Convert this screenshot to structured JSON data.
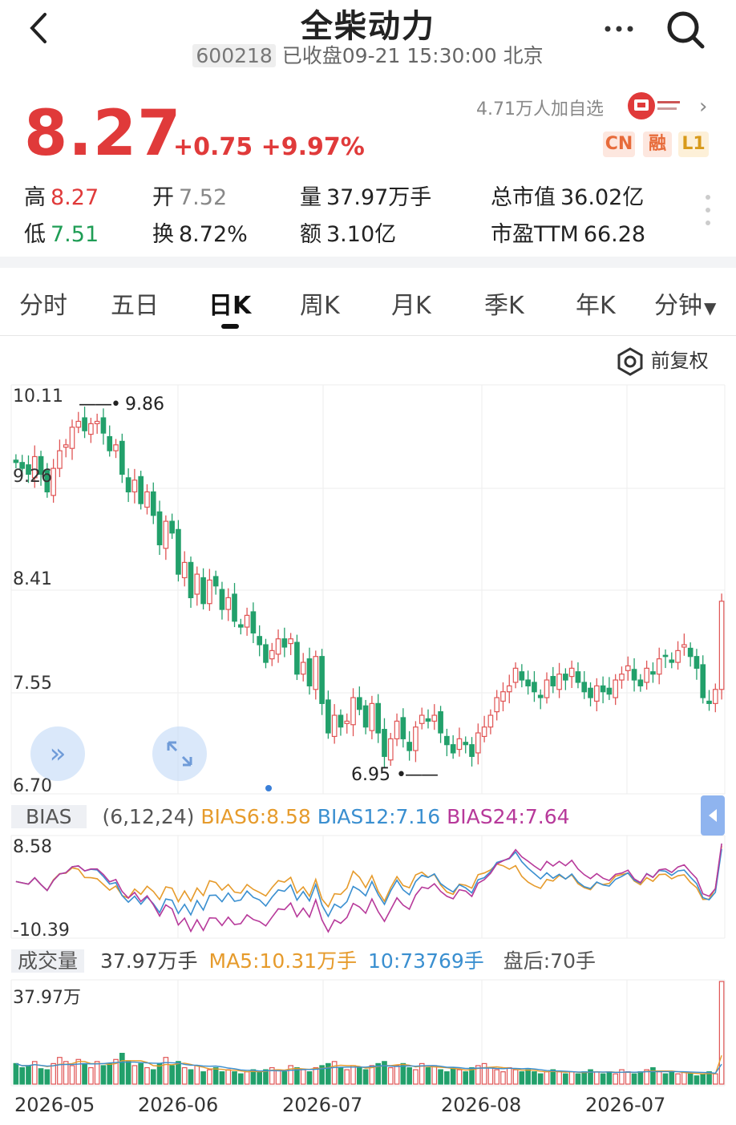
{
  "header": {
    "title": "全柴动力",
    "code": "600218",
    "status": "已收盘09-21 15:30:00 北京"
  },
  "quote": {
    "price": "8.27",
    "change": "+0.75",
    "change_pct": "+9.97%",
    "followers": "4.71万人加自选",
    "tags": [
      "CN",
      "融",
      "L1"
    ],
    "stats": [
      {
        "label": "高",
        "value": "8.27",
        "tone": "red"
      },
      {
        "label": "开",
        "value": "7.52",
        "tone": "gray"
      },
      {
        "label": "量",
        "value": "37.97万手",
        "tone": "dark"
      },
      {
        "label": "总市值",
        "value": "36.02亿",
        "tone": "dark"
      },
      {
        "label": "低",
        "value": "7.51",
        "tone": "green"
      },
      {
        "label": "换",
        "value": "8.72%",
        "tone": "dark"
      },
      {
        "label": "额",
        "value": "3.10亿",
        "tone": "dark"
      },
      {
        "label": "市盈TTM",
        "value": "66.28",
        "tone": "dark"
      }
    ]
  },
  "tabs": [
    "分时",
    "五日",
    "日K",
    "周K",
    "月K",
    "季K",
    "年K",
    "分钟"
  ],
  "active_tab": "日K",
  "adjust_label": "前复权",
  "chart_data": [
    {
      "type": "candlestick",
      "y_ticks": [
        "10.11",
        "9.26",
        "8.41",
        "7.55",
        "6.70"
      ],
      "ylim": [
        6.7,
        10.11
      ],
      "annotations": [
        {
          "label": "9.86",
          "value": 9.86
        },
        {
          "label": "6.95",
          "value": 6.95
        }
      ],
      "x_ticks": [
        "2026-05",
        "2026-06",
        "2026-07",
        "2026-08",
        "2026-07"
      ],
      "close": [
        9.45,
        9.4,
        9.35,
        9.5,
        9.35,
        9.2,
        9.4,
        9.55,
        9.6,
        9.75,
        9.8,
        9.72,
        9.78,
        9.8,
        9.7,
        9.55,
        9.6,
        9.35,
        9.2,
        9.3,
        9.1,
        9.2,
        9.0,
        8.75,
        8.95,
        8.85,
        8.5,
        8.6,
        8.3,
        8.5,
        8.25,
        8.45,
        8.4,
        8.2,
        8.3,
        8.1,
        8.05,
        8.15,
        8.0,
        7.9,
        7.75,
        7.85,
        7.95,
        7.88,
        7.95,
        7.65,
        7.75,
        7.55,
        7.8,
        7.4,
        7.15,
        7.3,
        7.2,
        7.25,
        7.45,
        7.35,
        7.2,
        7.4,
        7.15,
        6.95,
        7.1,
        7.25,
        7.1,
        7.0,
        7.2,
        7.3,
        7.25,
        7.3,
        7.15,
        7.05,
        6.98,
        7.1,
        7.05,
        6.95,
        7.15,
        7.2,
        7.3,
        7.45,
        7.5,
        7.55,
        7.7,
        7.6,
        7.55,
        7.5,
        7.45,
        7.6,
        7.55,
        7.65,
        7.6,
        7.7,
        7.58,
        7.5,
        7.45,
        7.55,
        7.5,
        7.48,
        7.6,
        7.65,
        7.72,
        7.6,
        7.55,
        7.7,
        7.65,
        7.78,
        7.8,
        7.75,
        7.85,
        7.9,
        7.8,
        7.7,
        7.45,
        7.4,
        7.52,
        8.27
      ],
      "volume": [
        0.2,
        0.16,
        0.18,
        0.22,
        0.15,
        0.14,
        0.2,
        0.26,
        0.22,
        0.18,
        0.24,
        0.2,
        0.16,
        0.22,
        0.18,
        0.2,
        0.24,
        0.3,
        0.22,
        0.18,
        0.2,
        0.16,
        0.14,
        0.2,
        0.26,
        0.18,
        0.22,
        0.16,
        0.14,
        0.18,
        0.12,
        0.14,
        0.16,
        0.12,
        0.14,
        0.12,
        0.1,
        0.12,
        0.14,
        0.12,
        0.14,
        0.16,
        0.14,
        0.12,
        0.18,
        0.16,
        0.14,
        0.12,
        0.16,
        0.18,
        0.2,
        0.22,
        0.16,
        0.14,
        0.18,
        0.16,
        0.14,
        0.18,
        0.2,
        0.22,
        0.16,
        0.18,
        0.2,
        0.16,
        0.14,
        0.2,
        0.16,
        0.18,
        0.14,
        0.12,
        0.16,
        0.14,
        0.12,
        0.16,
        0.18,
        0.2,
        0.16,
        0.14,
        0.12,
        0.16,
        0.14,
        0.12,
        0.14,
        0.12,
        0.1,
        0.12,
        0.14,
        0.12,
        0.1,
        0.12,
        0.1,
        0.12,
        0.14,
        0.12,
        0.1,
        0.12,
        0.1,
        0.14,
        0.12,
        0.1,
        0.12,
        0.14,
        0.16,
        0.12,
        0.1,
        0.12,
        0.1,
        0.12,
        0.1,
        0.08,
        0.1,
        0.12,
        0.1,
        1.0
      ]
    },
    {
      "type": "line",
      "name": "BIAS",
      "params": "(6,12,24)",
      "y_ticks": [
        "8.58",
        "-10.39"
      ],
      "series": [
        {
          "name": "BIAS6",
          "label": "BIAS6:8.58",
          "color": "#e69b2c"
        },
        {
          "name": "BIAS12",
          "label": "BIAS12:7.16",
          "color": "#3a8fd0"
        },
        {
          "name": "BIAS24",
          "label": "BIAS24:7.64",
          "color": "#b7399a"
        }
      ]
    },
    {
      "type": "bar",
      "name": "成交量",
      "y_ticks": [
        "37.97万"
      ],
      "legend": {
        "vol": "37.97万手",
        "ma5": "MA5:10.31万手",
        "ma10": "10:73769手",
        "after": "盘后:70手"
      }
    }
  ]
}
